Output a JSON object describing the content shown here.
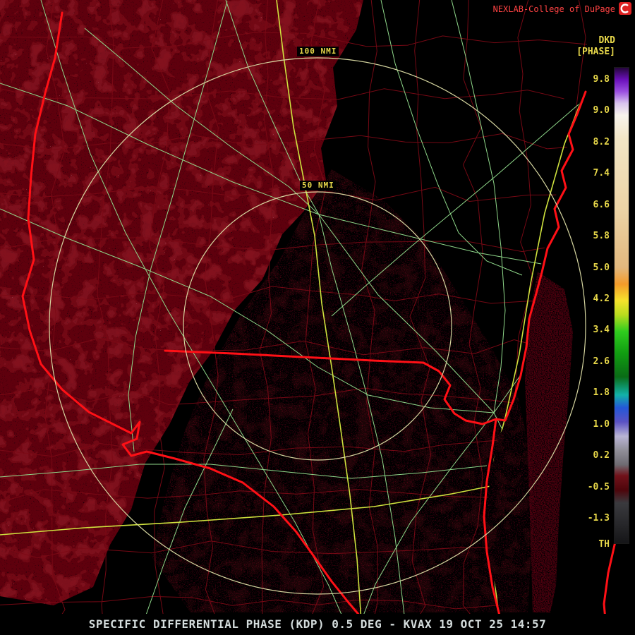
{
  "header": {
    "brand": "NEXLAB-College of DuPage",
    "product_code": "DKD",
    "product_units": "[PHASE]"
  },
  "range_rings": {
    "labels": [
      "100 NMI",
      "50 NMI"
    ]
  },
  "colorbar": {
    "tick_labels": [
      "9.8",
      "9.0",
      "8.2",
      "7.4",
      "6.6",
      "5.8",
      "5.0",
      "4.2",
      "3.4",
      "2.6",
      "1.8",
      "1.0",
      "0.2",
      "-0.5",
      "-1.3"
    ],
    "bottom_label": "TH",
    "gradient_stops": [
      {
        "pos": 0.0,
        "color": "#24053a"
      },
      {
        "pos": 0.025,
        "color": "#6b10bb"
      },
      {
        "pos": 0.05,
        "color": "#9b4fe0"
      },
      {
        "pos": 0.075,
        "color": "#d9c4ef"
      },
      {
        "pos": 0.1,
        "color": "#f7f3ec"
      },
      {
        "pos": 0.15,
        "color": "#f2e5c5"
      },
      {
        "pos": 0.3,
        "color": "#ecd3a5"
      },
      {
        "pos": 0.42,
        "color": "#e2b87e"
      },
      {
        "pos": 0.455,
        "color": "#f49b2a"
      },
      {
        "pos": 0.49,
        "color": "#f5e32c"
      },
      {
        "pos": 0.52,
        "color": "#b8dc1e"
      },
      {
        "pos": 0.555,
        "color": "#2ecc1e"
      },
      {
        "pos": 0.6,
        "color": "#119e11"
      },
      {
        "pos": 0.65,
        "color": "#0a6c16"
      },
      {
        "pos": 0.688,
        "color": "#12b2a8"
      },
      {
        "pos": 0.715,
        "color": "#2457d8"
      },
      {
        "pos": 0.745,
        "color": "#5b52c4"
      },
      {
        "pos": 0.775,
        "color": "#b9b4d4"
      },
      {
        "pos": 0.805,
        "color": "#908e98"
      },
      {
        "pos": 0.835,
        "color": "#6e6b72"
      },
      {
        "pos": 0.858,
        "color": "#71121a"
      },
      {
        "pos": 0.888,
        "color": "#4e050b"
      },
      {
        "pos": 0.915,
        "color": "#3a3a3e"
      },
      {
        "pos": 0.96,
        "color": "#27272a"
      },
      {
        "pos": 1.0,
        "color": "#151517"
      }
    ]
  },
  "status_bar": {
    "text": "SPECIFIC DIFFERENTIAL PHASE (KDP) 0.5 DEG - KVAX 19 OCT 25 14:57"
  },
  "colors": {
    "background": "#000000",
    "echo_dense": "#5e0011",
    "echo_blotch": "#8c1424",
    "echo_speckle_light": "#dfa0af",
    "echo_dim": "#46000d",
    "echo_coast": "#56000f",
    "county_lines": "#7c0a16",
    "roads": "#8fd88a",
    "highways": "#cfe23e",
    "borders": "#ff1016",
    "range_rings": "#d6d6a0",
    "label_yellow": "#e8d84a",
    "brand_red": "#ff4343",
    "status_text": "#d4dcdc"
  }
}
